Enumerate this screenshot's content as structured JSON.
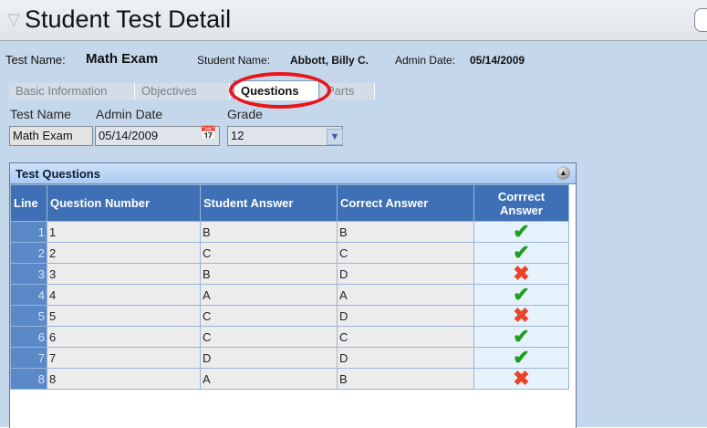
{
  "title": "Student Test Detail",
  "info": {
    "test_name_label": "Test Name:",
    "test_name": "Math Exam",
    "student_name_label": "Student Name:",
    "student_name": "Abbott, Billy C.",
    "admin_date_label": "Admin Date:",
    "admin_date": "05/14/2009"
  },
  "tabs": [
    {
      "label": "Basic Information",
      "active": false
    },
    {
      "label": "Objectives",
      "active": false
    },
    {
      "label": "Questions",
      "active": true
    },
    {
      "label": "Parts",
      "active": false
    }
  ],
  "fields": {
    "test_name_label": "Test Name",
    "admin_date_label": "Admin Date",
    "grade_label": "Grade",
    "test_name_value": "Math Exam",
    "admin_date_value": "05/14/2009",
    "grade_value": "12"
  },
  "grid": {
    "title": "Test Questions",
    "columns": [
      "Line",
      "Question Number",
      "Student Answer",
      "Correct Answer",
      "Corrrect Answer"
    ],
    "rows": [
      {
        "line": "1",
        "question": "1",
        "student": "B",
        "correct": "B",
        "is_correct": true
      },
      {
        "line": "2",
        "question": "2",
        "student": "C",
        "correct": "C",
        "is_correct": true
      },
      {
        "line": "3",
        "question": "3",
        "student": "B",
        "correct": "D",
        "is_correct": false
      },
      {
        "line": "4",
        "question": "4",
        "student": "A",
        "correct": "A",
        "is_correct": true
      },
      {
        "line": "5",
        "question": "5",
        "student": "C",
        "correct": "D",
        "is_correct": false
      },
      {
        "line": "6",
        "question": "6",
        "student": "C",
        "correct": "C",
        "is_correct": true
      },
      {
        "line": "7",
        "question": "7",
        "student": "D",
        "correct": "D",
        "is_correct": true
      },
      {
        "line": "8",
        "question": "8",
        "student": "A",
        "correct": "B",
        "is_correct": false
      }
    ]
  },
  "colors": {
    "correct_mark": "#1e9e1e",
    "incorrect_mark": "#e8442a",
    "highlight": "#e8151b"
  }
}
